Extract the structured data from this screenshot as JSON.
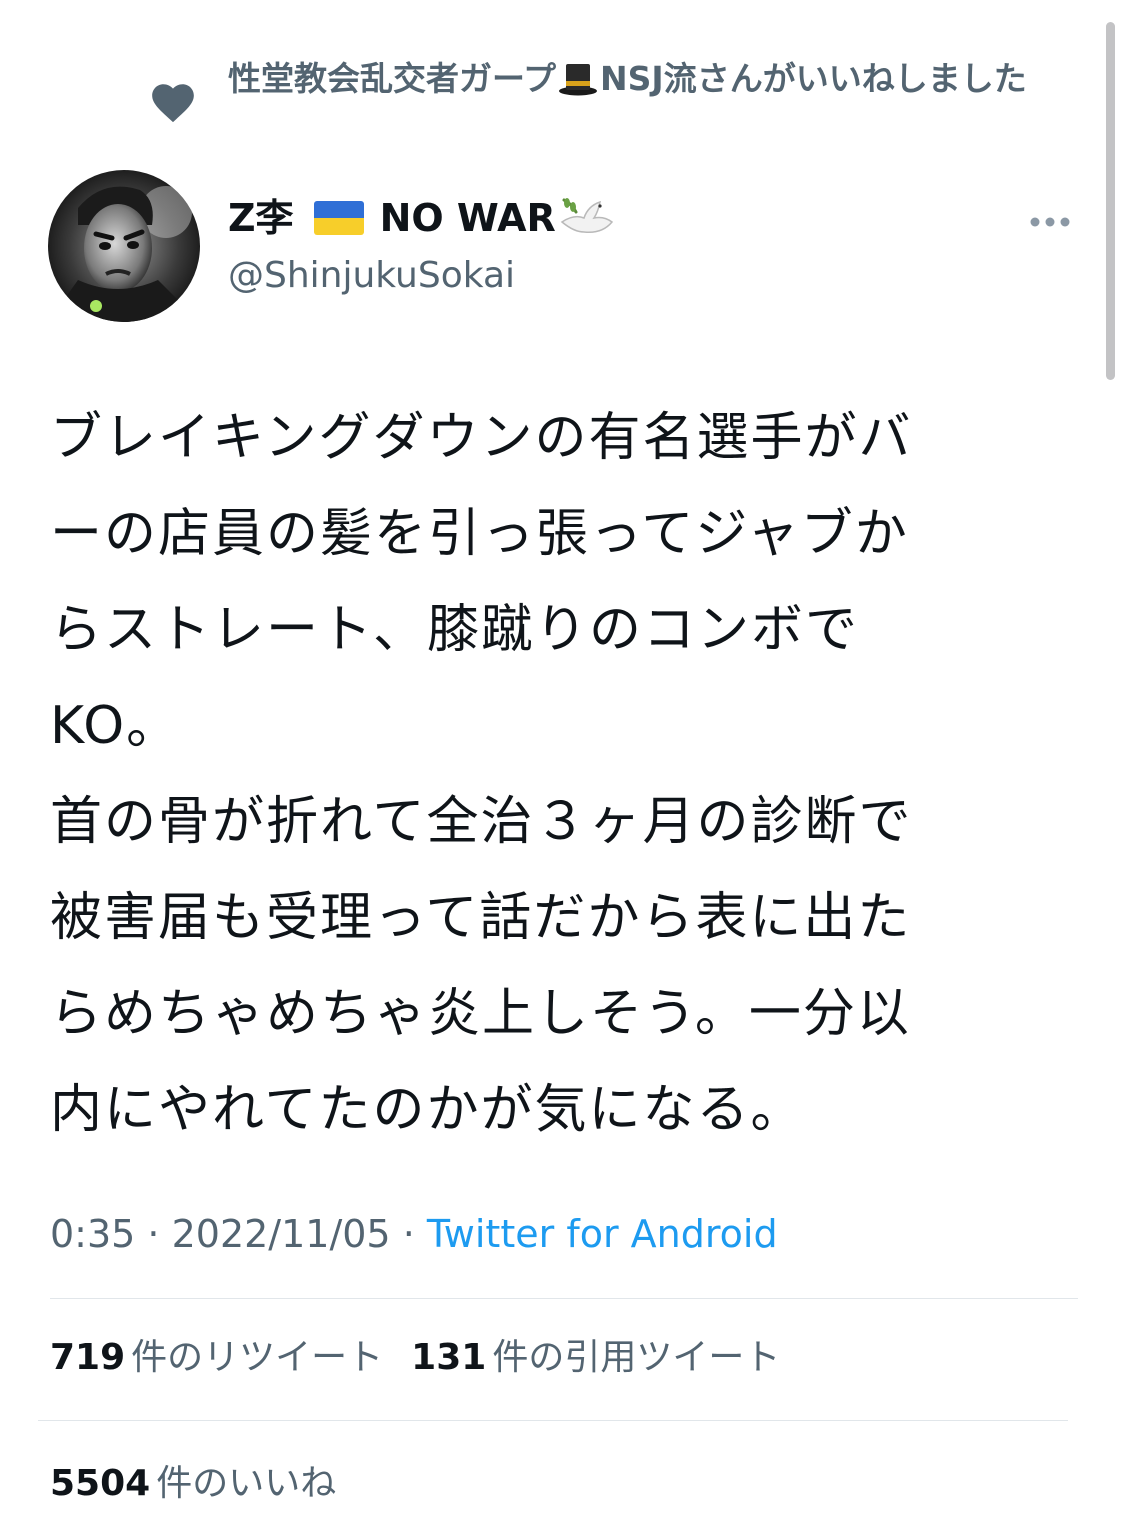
{
  "social_context": {
    "text_before": "性堂教会乱交者ガープ",
    "emoji": "top-hat-emoji",
    "text_after": "NSJ流さんがいいねしました",
    "icon": "heart-icon"
  },
  "author": {
    "name_part1": "Z李",
    "name_flag": "ukraine-flag-emoji",
    "name_part2": "NO WAR",
    "name_dove": "dove-emoji",
    "handle": "@ShinjukuSokai"
  },
  "tweet": {
    "lines": [
      "ブレイキングダウンの有名選手がバ",
      "ーの店員の髪を引っ張ってジャブか",
      "らストレート、膝蹴りのコンボで",
      "KO。",
      "首の骨が折れて全治３ヶ月の診断で",
      "被害届も受理って話だから表に出た",
      "らめちゃめちゃ炎上しそう。一分以",
      "内にやれてたのかが気になる。"
    ],
    "time": "0:35",
    "separator1": " · ",
    "date": "2022/11/05",
    "separator2": " · ",
    "source": "Twitter for Android"
  },
  "stats": {
    "retweets_count": "719",
    "retweets_label": "件のリツイート",
    "quotes_count": "131",
    "quotes_label": "件の引用ツイート",
    "likes_count": "5504",
    "likes_label": "件のいいね"
  },
  "colors": {
    "text_primary": "#0f1419",
    "text_secondary": "#536471",
    "link": "#1d9bf0",
    "divider": "#e1e6ea"
  }
}
